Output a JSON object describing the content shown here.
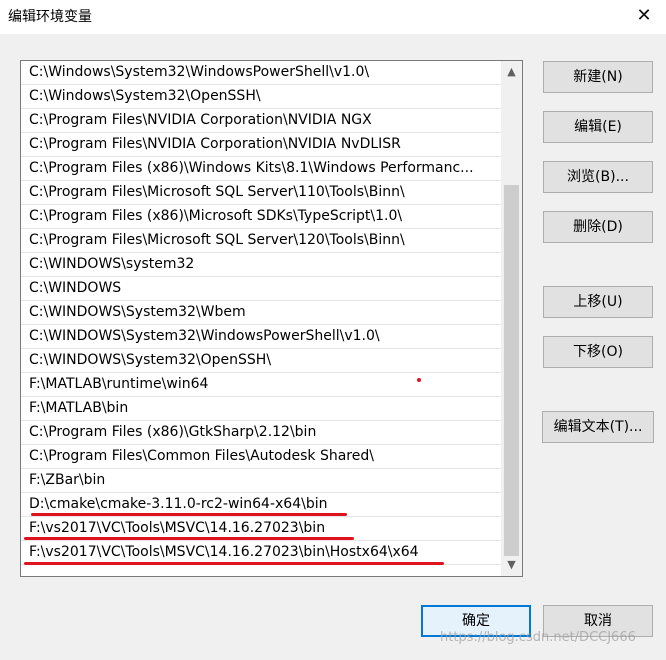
{
  "window": {
    "title": "编辑环境变量",
    "close_glyph": "✕"
  },
  "paths": [
    "C:\\Windows\\System32\\WindowsPowerShell\\v1.0\\",
    "C:\\Windows\\System32\\OpenSSH\\",
    "C:\\Program Files\\NVIDIA Corporation\\NVIDIA NGX",
    "C:\\Program Files\\NVIDIA Corporation\\NVIDIA NvDLISR",
    "C:\\Program Files (x86)\\Windows Kits\\8.1\\Windows Performanc...",
    "C:\\Program Files\\Microsoft SQL Server\\110\\Tools\\Binn\\",
    "C:\\Program Files (x86)\\Microsoft SDKs\\TypeScript\\1.0\\",
    "C:\\Program Files\\Microsoft SQL Server\\120\\Tools\\Binn\\",
    "C:\\WINDOWS\\system32",
    "C:\\WINDOWS",
    "C:\\WINDOWS\\System32\\Wbem",
    "C:\\WINDOWS\\System32\\WindowsPowerShell\\v1.0\\",
    "C:\\WINDOWS\\System32\\OpenSSH\\",
    "F:\\MATLAB\\runtime\\win64",
    "F:\\MATLAB\\bin",
    "C:\\Program Files (x86)\\GtkSharp\\2.12\\bin",
    "C:\\Program Files\\Common Files\\Autodesk Shared\\",
    "F:\\ZBar\\bin",
    "D:\\cmake\\cmake-3.11.0-rc2-win64-x64\\bin",
    "F:\\vs2017\\VC\\Tools\\MSVC\\14.16.27023\\bin",
    "F:\\vs2017\\VC\\Tools\\MSVC\\14.16.27023\\bin\\Hostx64\\x64"
  ],
  "scrollbar": {
    "up_glyph": "▲",
    "down_glyph": "▼"
  },
  "buttons": {
    "new": "新建(N)",
    "edit": "编辑(E)",
    "browse": "浏览(B)...",
    "delete": "删除(D)",
    "move_up": "上移(U)",
    "move_down": "下移(O)",
    "edit_text": "编辑文本(T)...",
    "ok": "确定",
    "cancel": "取消"
  },
  "colors": {
    "annotation": "#e0141e",
    "ok_border": "#0078d7"
  },
  "watermark": "https://blog.csdn.net/DCCJ666"
}
